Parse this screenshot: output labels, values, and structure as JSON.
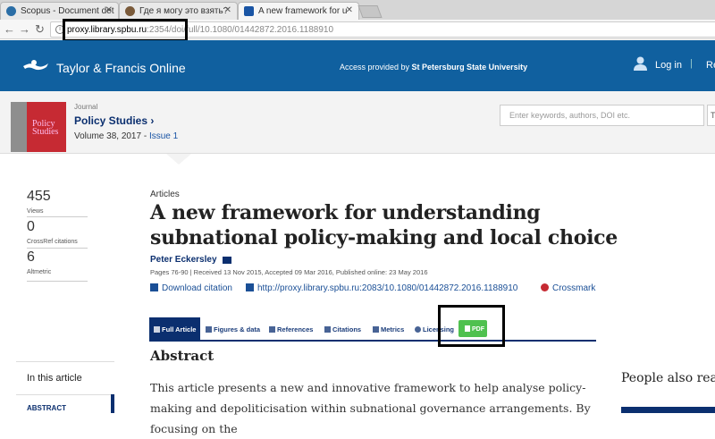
{
  "browser": {
    "tabs": [
      {
        "label": "Scopus - Document det",
        "icon_color": "#e67e22"
      },
      {
        "label": "Где я могу это взять?",
        "icon_color": "#8e44ad"
      },
      {
        "label": "A new framework for u",
        "icon_color": "#1a55a5"
      }
    ],
    "url_host": "proxy.library.spbu.ru",
    "url_rest": ":2354/doi/full/10.1080/01442872.2016.1188910"
  },
  "header": {
    "logo": "Taylor & Francis Online",
    "access_prefix": "Access provided by ",
    "access_org": "St Petersburg State University",
    "login": "Log in",
    "separator": "|",
    "register": "Re"
  },
  "journal": {
    "label": "Journal",
    "name": "Policy Studies ›",
    "volume": "Volume 38, 2017 - ",
    "issue": "Issue 1",
    "cover_title": "Policy Studies",
    "search_placeholder": "Enter keywords, authors, DOI etc.",
    "search_button": "T"
  },
  "metrics": [
    {
      "value": "455",
      "label": "Views"
    },
    {
      "value": "0",
      "label": "CrossRef citations"
    },
    {
      "value": "6",
      "label": "Altmetric"
    }
  ],
  "article": {
    "type": "Articles",
    "title": "A new framework for understanding subnational policy-making and local choice",
    "author": "Peter Eckersley",
    "pages_info": "Pages 76-90 | Received 13 Nov 2015, Accepted 09 Mar 2016, Published online: 23 May 2016",
    "download_citation": "Download citation",
    "doi_link": "http://proxy.library.spbu.ru:2083/10.1080/01442872.2016.1188910",
    "crossmark": "Crossmark"
  },
  "article_tabs": {
    "full_article": "Full Article",
    "figures": "Figures & data",
    "references": "References",
    "citations": "Citations",
    "metrics": "Metrics",
    "licensing": "Licensing",
    "pdf": "PDF"
  },
  "abstract": {
    "heading": "Abstract",
    "text": "This article presents a new and innovative framework to help analyse policy-making and depoliticisation within subnational governance arrangements. By focusing on the"
  },
  "sidebar": {
    "heading": "In this article",
    "first_item": "ABSTRACT"
  },
  "right_panel": {
    "heading": "People also read"
  }
}
